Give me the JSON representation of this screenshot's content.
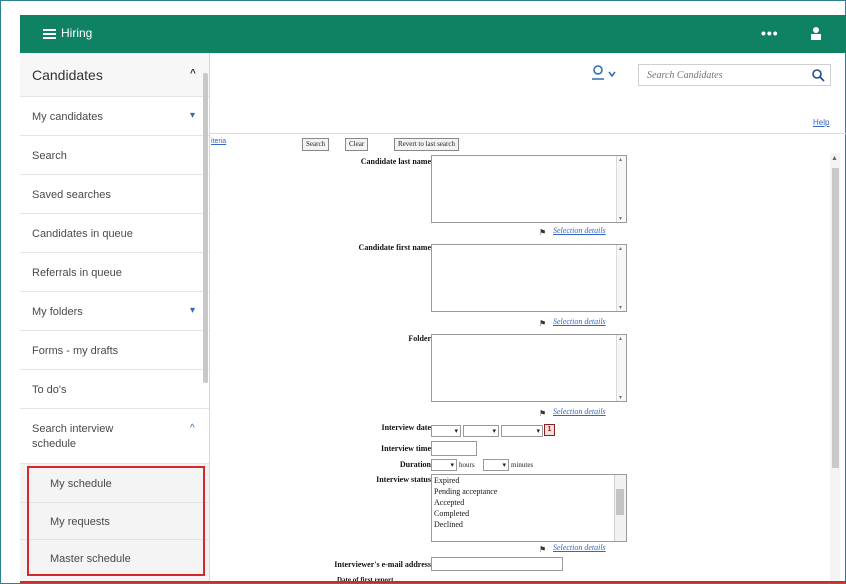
{
  "app": {
    "title": "Hiring"
  },
  "search": {
    "placeholder": "Search Candidates"
  },
  "help": "Help",
  "criteria_link": "iteria",
  "buttons": {
    "search": "Search",
    "clear": "Clear",
    "revert": "Revert to last search"
  },
  "sidebar": {
    "header": "Candidates",
    "items": [
      {
        "label": "My candidates",
        "chevron": "down"
      },
      {
        "label": "Search"
      },
      {
        "label": "Saved searches"
      },
      {
        "label": "Candidates in queue"
      },
      {
        "label": "Referrals in queue"
      },
      {
        "label": "My folders",
        "chevron": "down"
      },
      {
        "label": "Forms - my drafts"
      },
      {
        "label": "To do's"
      },
      {
        "label": "Search interview schedule",
        "chevron": "up"
      }
    ],
    "subitems": [
      "My schedule",
      "My requests",
      "Master schedule"
    ]
  },
  "form": {
    "last_name": "Candidate last name",
    "first_name": "Candidate first name",
    "folder": "Folder",
    "selection_details": "Selection details",
    "interview_date": "Interview date",
    "date_icon_label": "1",
    "interview_time": "Interview time",
    "duration": "Duration",
    "hours": "hours",
    "minutes": "minutes",
    "interview_status": "Interview status",
    "status_options": [
      "Expired",
      "Pending acceptance",
      "Accepted",
      "Completed",
      "Declined"
    ],
    "interviewer_email": "Interviewer's e-mail address",
    "cutoff_label": "Date of first report"
  },
  "colors": {
    "topbar": "#0f8263",
    "highlight": "#d9262b",
    "link": "#3366cc"
  }
}
